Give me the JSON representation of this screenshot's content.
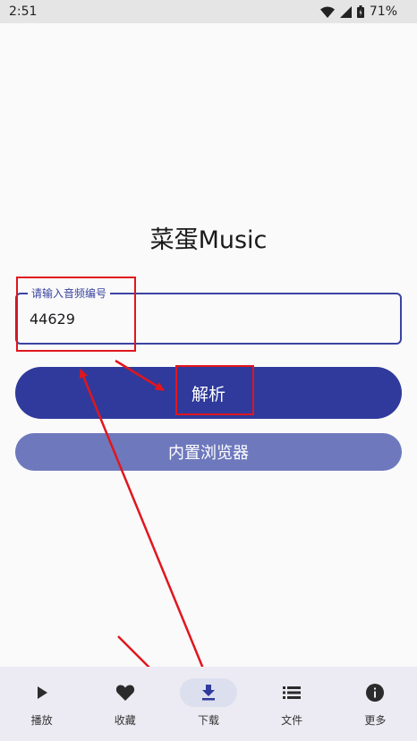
{
  "status_bar": {
    "time": "2:51",
    "battery": "71%",
    "icons": [
      "wifi-icon",
      "signal-icon",
      "battery-icon"
    ]
  },
  "app": {
    "title": "菜蛋Music"
  },
  "input": {
    "label": "请输入音频编号",
    "value": "44629"
  },
  "buttons": {
    "parse": "解析",
    "browser": "内置浏览器"
  },
  "bottom_nav": {
    "items": [
      {
        "label": "播放",
        "icon": "play-icon",
        "active": false
      },
      {
        "label": "收藏",
        "icon": "heart-icon",
        "active": false
      },
      {
        "label": "下载",
        "icon": "download-icon",
        "active": true
      },
      {
        "label": "文件",
        "icon": "list-icon",
        "active": false
      },
      {
        "label": "更多",
        "icon": "info-icon",
        "active": false
      }
    ]
  },
  "colors": {
    "primary": "#2f3a9c",
    "secondary_button": "#6e79bd",
    "annotation": "#e0161d",
    "nav_background": "#ecebf3"
  }
}
